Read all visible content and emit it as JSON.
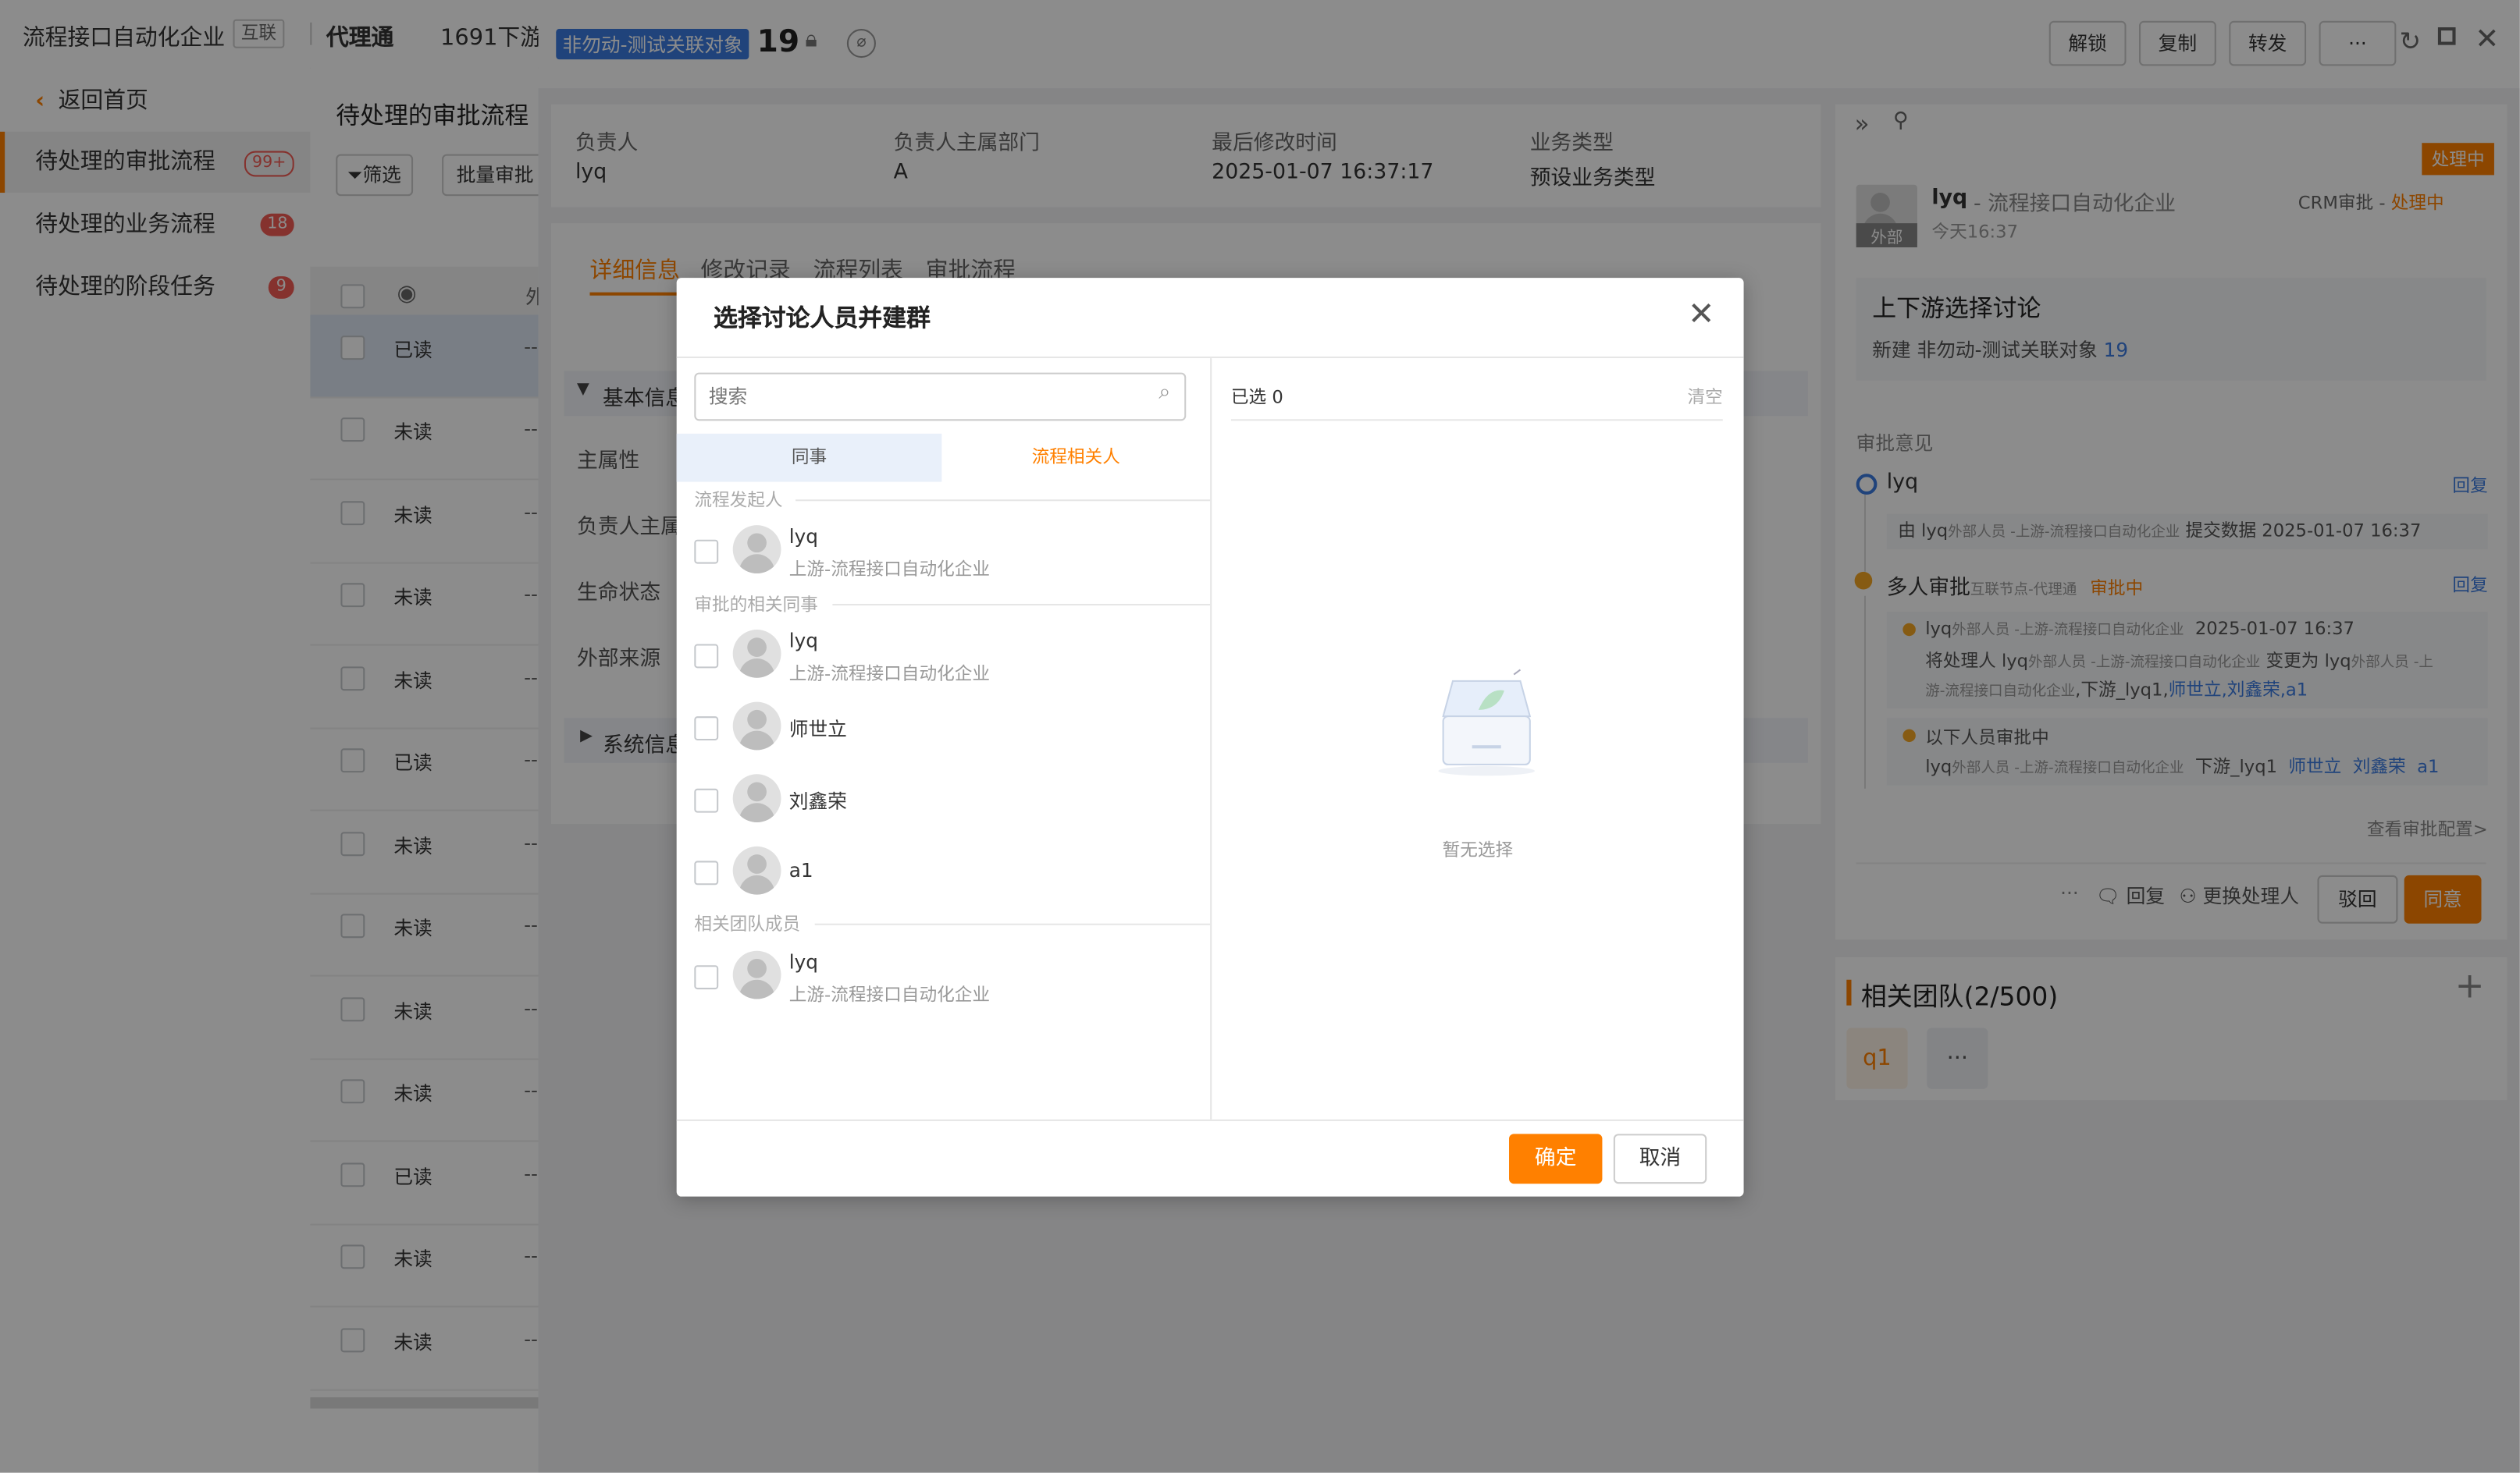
{
  "topbar": {
    "company": "流程接口自动化企业",
    "company_tag": "互联",
    "app": "代理通",
    "partner": "1691下游...",
    "object_tag": "非勿动-测试关联对象",
    "record_no": "19",
    "buttons": [
      "解锁",
      "复制",
      "转发",
      "···"
    ]
  },
  "sidebar": {
    "back": "返回首页",
    "items": [
      {
        "label": "待处理的审批流程",
        "badge": "99+"
      },
      {
        "label": "待处理的业务流程",
        "badge": "18"
      },
      {
        "label": "待处理的阶段任务",
        "badge": "9"
      }
    ]
  },
  "list": {
    "title": "待处理的审批流程",
    "filter": "筛选",
    "batch": "批量审批",
    "col_head": "外",
    "rows": [
      "已读",
      "未读",
      "未读",
      "未读",
      "未读",
      "已读",
      "未读",
      "未读",
      "未读",
      "未读",
      "已读",
      "未读",
      "未读"
    ],
    "dash": "--"
  },
  "detail": {
    "summary": [
      {
        "label": "负责人",
        "value": "lyq"
      },
      {
        "label": "负责人主属部门",
        "value": "A"
      },
      {
        "label": "最后修改时间",
        "value": "2025-01-07 16:37:17"
      },
      {
        "label": "业务类型",
        "value": "预设业务类型"
      }
    ],
    "tabs": [
      "详细信息",
      "修改记录",
      "流程列表",
      "审批流程"
    ],
    "basic_section": "基本信息",
    "fields": [
      "主属性",
      "负责人主属部门",
      "生命状态",
      "外部来源"
    ],
    "system_section": "系统信息"
  },
  "approval": {
    "status_tag": "处理中",
    "user": "lyq",
    "company": "流程接口自动化企业",
    "crm_label": "CRM审批 -",
    "crm_status": "处理中",
    "time": "今天16:37",
    "avatar_tag": "外部",
    "title": "上下游选择讨论",
    "subtitle": "新建 非勿动-测试关联对象",
    "subtitle_no": "19",
    "opinion_label": "审批意见",
    "step1_user": "lyq",
    "reply": "回复",
    "step1_detail_prefix": "由",
    "step1_detail_user": "lyq",
    "step1_detail_org": "外部人员 -上游-流程接口自动化企业",
    "step1_detail_action": "提交数据 2025-01-07 16:37",
    "step2_title": "多人审批",
    "step2_node": "互联节点-代理通",
    "step2_status": "审批中",
    "sub1_user": "lyq",
    "sub1_org": "外部人员 -上游-流程接口自动化企业",
    "sub1_time": "2025-01-07 16:37",
    "sub1_line1_a": "将处理人",
    "sub1_line1_b": "lyq",
    "sub1_line1_c": "外部人员 -上游-流程接口自动化企业",
    "sub1_line1_d": "变更为",
    "sub1_line1_e": "lyq",
    "sub1_line1_f": "外部人员 -上",
    "sub1_line2_a": "游-流程接口自动化企业",
    "sub1_line2_b": ",下游_lyq1,",
    "sub1_line2_c": "师世立,刘鑫荣,a1",
    "sub2_title": "以下人员审批中",
    "sub2_user": "lyq",
    "sub2_org": "外部人员 -上游-流程接口自动化企业",
    "sub2_d": "下游_lyq1",
    "sub2_e": "师世立",
    "sub2_f": "刘鑫荣",
    "sub2_g": "a1",
    "config_link": "查看审批配置>",
    "actions": {
      "more": "···",
      "reply": "回复",
      "change": "更换处理人",
      "reject": "驳回",
      "agree": "同意"
    }
  },
  "team": {
    "title": "相关团队(2/500)",
    "add": "+",
    "member": "q1",
    "more": "···"
  },
  "modal": {
    "title": "选择讨论人员并建群",
    "search_placeholder": "搜索",
    "tabs": [
      "同事",
      "流程相关人"
    ],
    "groups": {
      "initiator": "流程发起人",
      "colleagues": "审批的相关同事",
      "team": "相关团队成员"
    },
    "people": {
      "initiator": [
        {
          "name": "lyq",
          "org": "上游-流程接口自动化企业"
        }
      ],
      "colleagues": [
        {
          "name": "lyq",
          "org": "上游-流程接口自动化企业"
        },
        {
          "name": "师世立",
          "org": ""
        },
        {
          "name": "刘鑫荣",
          "org": ""
        },
        {
          "name": "a1",
          "org": ""
        }
      ],
      "team": [
        {
          "name": "lyq",
          "org": "上游-流程接口自动化企业"
        }
      ]
    },
    "selected_label": "已选 0",
    "clear": "清空",
    "empty": "暂无选择",
    "ok": "确定",
    "cancel": "取消"
  },
  "colors": {
    "accent": "#ff8000",
    "link": "#3b7be0",
    "badge": "#f25c54",
    "tag_blue": "#3b7be0"
  }
}
